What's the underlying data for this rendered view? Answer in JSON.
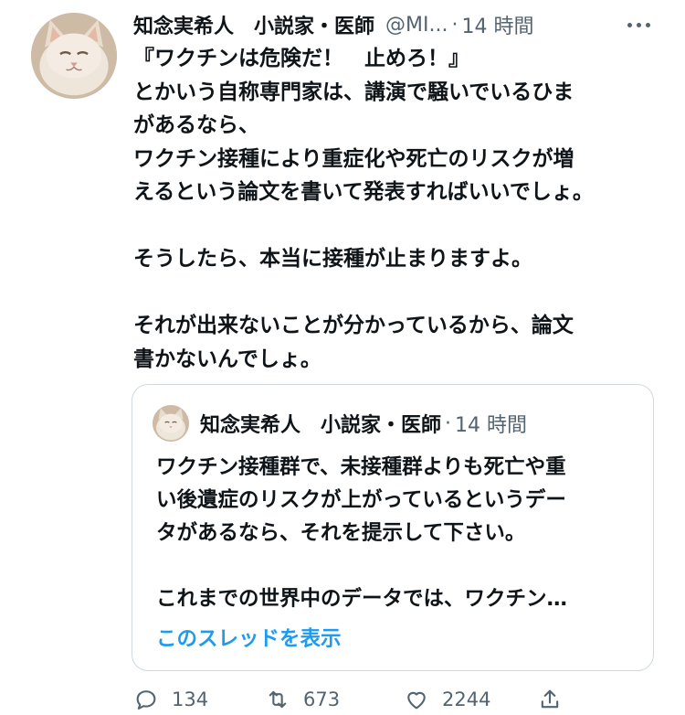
{
  "tweet": {
    "author_name": "知念実希人　小説家・医師",
    "author_handle": "@MI...",
    "separator": "·",
    "time": "14 時間",
    "body_lines": [
      "『ワクチンは危険だ！　止めろ！』",
      "とかいう自称専門家は、講演で騒いでいるひま",
      "があるなら、",
      "ワクチン接種により重症化や死亡のリスクが増",
      "えるという論文を書いて発表すればいいでしょ。",
      "",
      "そうしたら、本当に接種が止まりますよ。",
      "",
      "それが出来ないことが分かっているから、論文",
      "書かないんでしょ。"
    ]
  },
  "quote": {
    "author_name": "知念実希人　小説家・医師",
    "separator": "·",
    "time": "14 時間",
    "body_lines": [
      "ワクチン接種群で、未接種群よりも死亡や重",
      "い後遺症のリスクが上がっているというデー",
      "タがあるなら、それを提示して下さい。",
      "",
      "これまでの世界中のデータでは、ワクチン…"
    ],
    "show_thread_label": "このスレッドを表示"
  },
  "actions": {
    "reply_count": "134",
    "retweet_count": "673",
    "like_count": "2244"
  },
  "icons": {
    "reply": "reply-icon",
    "retweet": "retweet-icon",
    "like": "heart-icon",
    "share": "share-icon",
    "more": "more-icon"
  },
  "colors": {
    "text": "#0f1419",
    "secondary": "#536471",
    "link": "#1d9bf0",
    "border": "#cfd9de"
  }
}
